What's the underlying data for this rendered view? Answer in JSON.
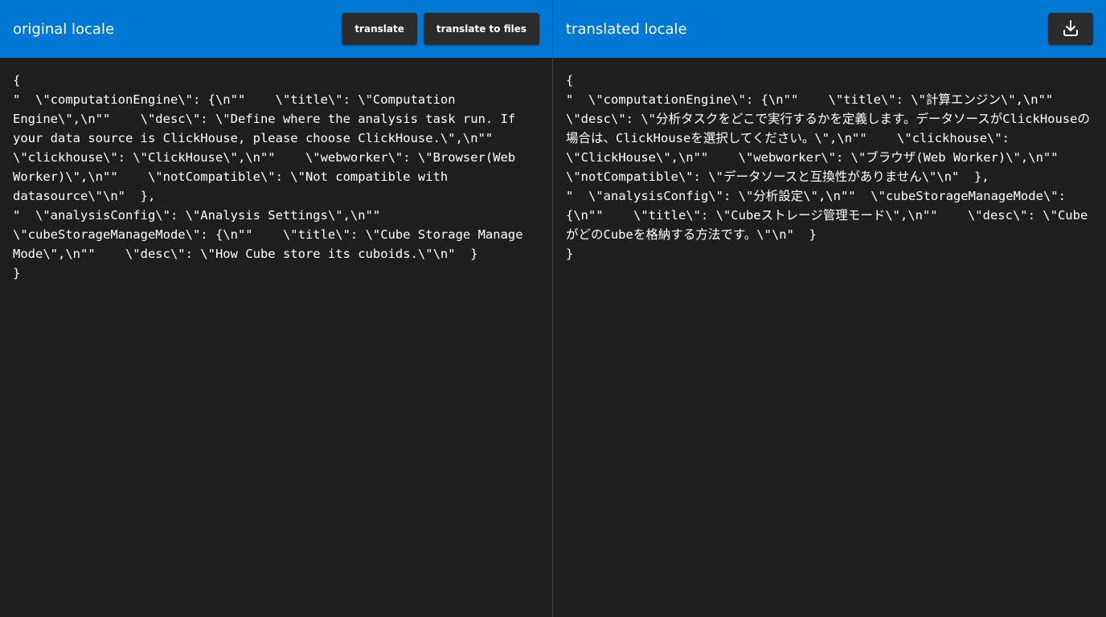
{
  "left": {
    "title": "original locale",
    "translate_label": "translate",
    "translate_files_label": "translate to files",
    "content": "{\n\"  \\\"computationEngine\\\": {\\n\"\"    \\\"title\\\": \\\"Computation Engine\\\",\\n\"\"    \\\"desc\\\": \\\"Define where the analysis task run. If your data source is ClickHouse, please choose ClickHouse.\\\",\\n\"\"    \\\"clickhouse\\\": \\\"ClickHouse\\\",\\n\"\"    \\\"webworker\\\": \\\"Browser(Web Worker)\\\",\\n\"\"    \\\"notCompatible\\\": \\\"Not compatible with datasource\\\"\\n\"  },\n\"  \\\"analysisConfig\\\": \\\"Analysis Settings\\\",\\n\"\"  \\\"cubeStorageManageMode\\\": {\\n\"\"    \\\"title\\\": \\\"Cube Storage Manage Mode\\\",\\n\"\"    \\\"desc\\\": \\\"How Cube store its cuboids.\\\"\\n\"  }\n}"
  },
  "right": {
    "title": "translated locale",
    "download_icon": "download-icon",
    "content": "{\n\"  \\\"computationEngine\\\": {\\n\"\"    \\\"title\\\": \\\"計算エンジン\\\",\\n\"\"    \\\"desc\\\": \\\"分析タスクをどこで実行するかを定義します。データソースがClickHouseの場合は、ClickHouseを選択してください。\\\",\\n\"\"    \\\"clickhouse\\\": \\\"ClickHouse\\\",\\n\"\"    \\\"webworker\\\": \\\"ブラウザ(Web Worker)\\\",\\n\"\"    \\\"notCompatible\\\": \\\"データソースと互換性がありません\\\"\\n\"  },\n\"  \\\"analysisConfig\\\": \\\"分析設定\\\",\\n\"\"  \\\"cubeStorageManageMode\\\": {\\n\"\"    \\\"title\\\": \\\"Cubeストレージ管理モード\\\",\\n\"\"    \\\"desc\\\": \\\"CubeがどのCubeを格納する方法です。\\\"\\n\"  }\n}"
  },
  "colors": {
    "header": "#0078d4",
    "background": "#1e1e1e",
    "button": "#2b2b2b",
    "text": "#ffffff"
  }
}
